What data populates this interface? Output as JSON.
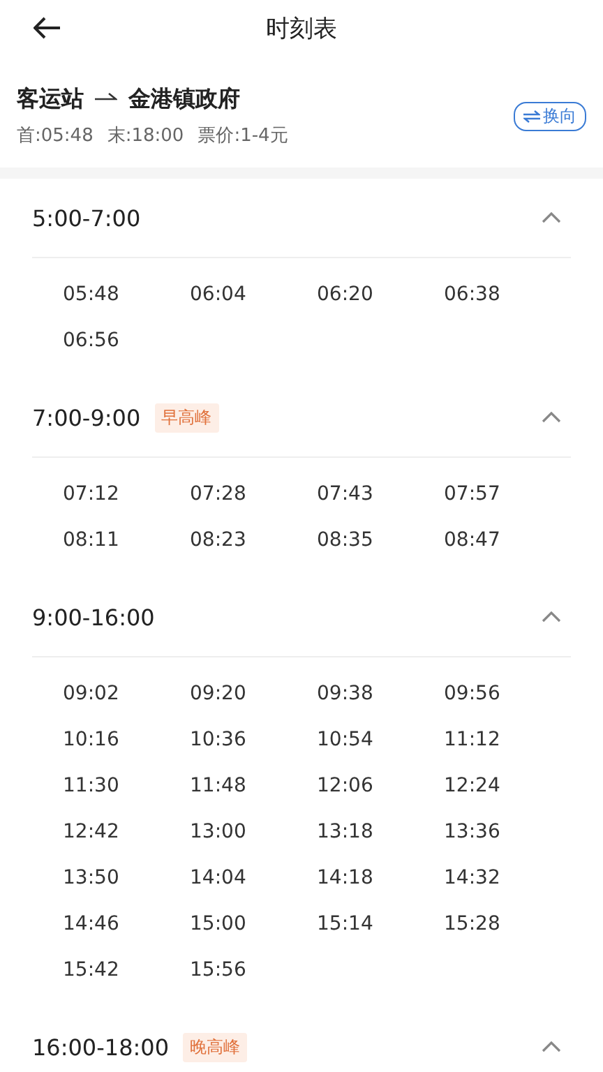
{
  "header": {
    "title": "时刻表"
  },
  "route": {
    "from": "客运站",
    "to": "金港镇政府",
    "first": "首:05:48",
    "last": "末:18:00",
    "fare": "票价:1-4元",
    "swap_label": "换向"
  },
  "sections": [
    {
      "range": "5:00-7:00",
      "expanded": true,
      "times": [
        "05:48",
        "06:04",
        "06:20",
        "06:38",
        "06:56"
      ]
    },
    {
      "range": "7:00-9:00",
      "tag": "早高峰",
      "expanded": true,
      "times": [
        "07:12",
        "07:28",
        "07:43",
        "07:57",
        "08:11",
        "08:23",
        "08:35",
        "08:47"
      ]
    },
    {
      "range": "9:00-16:00",
      "expanded": true,
      "times": [
        "09:02",
        "09:20",
        "09:38",
        "09:56",
        "10:16",
        "10:36",
        "10:54",
        "11:12",
        "11:30",
        "11:48",
        "12:06",
        "12:24",
        "12:42",
        "13:00",
        "13:18",
        "13:36",
        "13:50",
        "14:04",
        "14:18",
        "14:32",
        "14:46",
        "15:00",
        "15:14",
        "15:28",
        "15:42",
        "15:56"
      ]
    },
    {
      "range": "16:00-18:00",
      "tag": "晚高峰",
      "expanded": true
    }
  ]
}
